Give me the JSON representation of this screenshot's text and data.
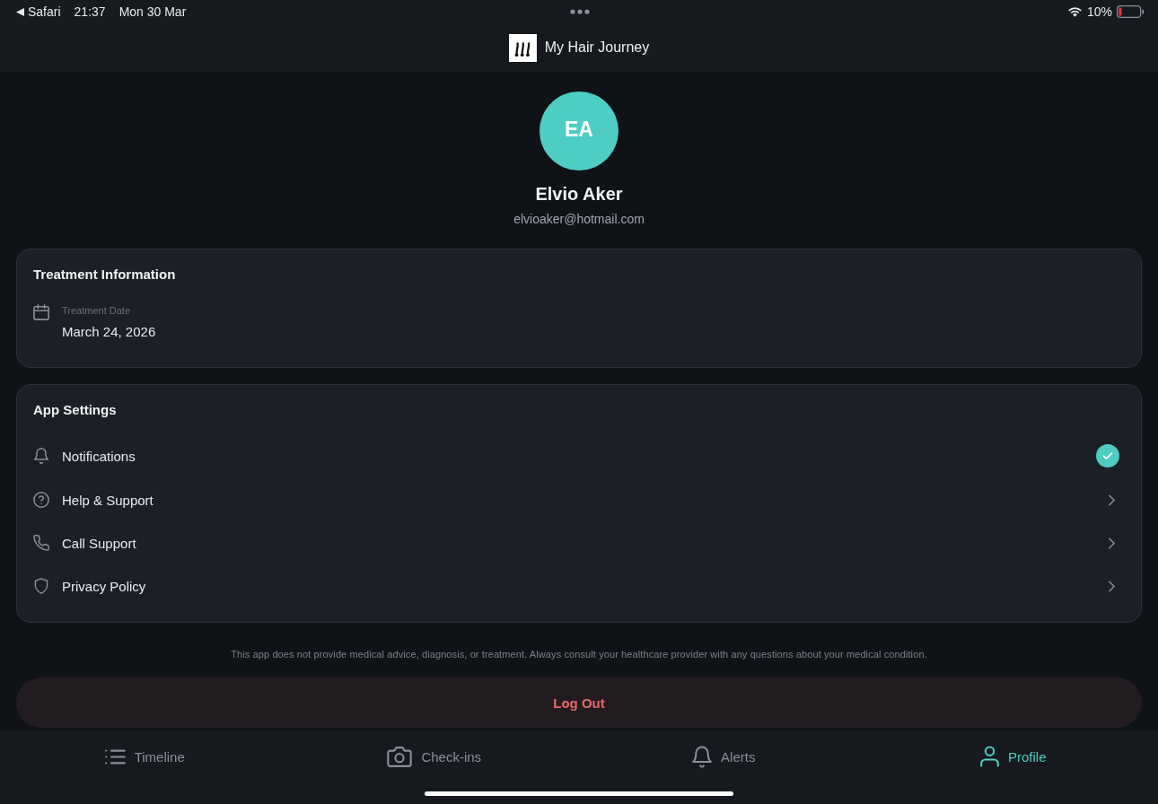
{
  "status_bar": {
    "back_app": "Safari",
    "time": "21:37",
    "date": "Mon 30 Mar",
    "battery": "10%"
  },
  "header": {
    "title": "My Hair Journey"
  },
  "profile": {
    "initials": "EA",
    "name": "Elvio Aker",
    "email": "elvioaker@hotmail.com"
  },
  "treatment": {
    "title": "Treatment Information",
    "fields": [
      {
        "label": "Treatment Date",
        "value": "March 24, 2026"
      }
    ]
  },
  "settings": {
    "title": "App Settings",
    "items": [
      {
        "kind": "toggle",
        "label": "Notifications",
        "checked": true
      },
      {
        "kind": "link",
        "label": "Help & Support"
      },
      {
        "kind": "link",
        "label": "Call Support"
      },
      {
        "kind": "link",
        "label": "Privacy Policy"
      }
    ]
  },
  "disclaimer": "This app does not provide medical advice, diagnosis, or treatment. Always consult your healthcare provider with any questions about your medical condition.",
  "logout": {
    "label": "Log Out"
  },
  "tab_bar": {
    "tabs": [
      {
        "label": "Timeline",
        "selected": false
      },
      {
        "label": "Check-ins",
        "selected": false
      },
      {
        "label": "Alerts",
        "selected": false
      },
      {
        "label": "Profile",
        "selected": true
      }
    ]
  }
}
